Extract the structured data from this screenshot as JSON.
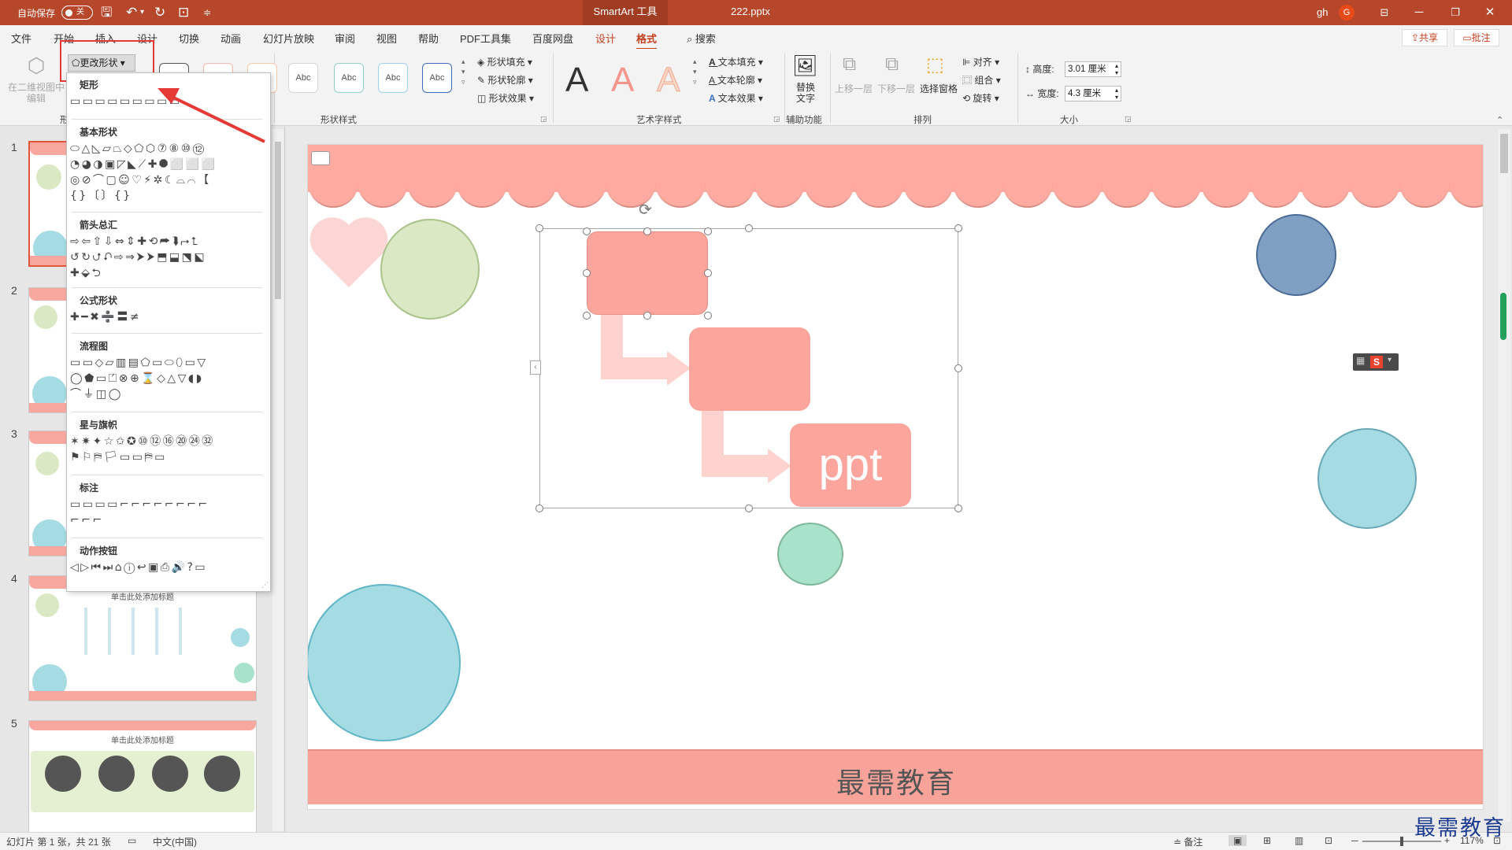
{
  "titlebar": {
    "autosave_label": "自动保存",
    "autosave_state": "关",
    "context_tab": "SmartArt 工具",
    "filename": "222.pptx",
    "user": "gh",
    "avatar_initial": "G"
  },
  "tabs": [
    "文件",
    "开始",
    "插入",
    "设计",
    "切换",
    "动画",
    "幻灯片放映",
    "审阅",
    "视图",
    "帮助",
    "PDF工具集",
    "百度网盘",
    "设计",
    "格式"
  ],
  "search_label": "搜索",
  "share_label": "共享",
  "comment_label": "批注",
  "ribbon": {
    "edit_in_2d": "在二维视图中编辑",
    "change_shape": "更改形状",
    "shape_styles_label": "形状样式",
    "abc_label": "Abc",
    "shape_fill": "形状填充",
    "shape_outline": "形状轮廓",
    "shape_effects": "形状效果",
    "wordart_label": "艺术字样式",
    "text_fill": "文本填充",
    "text_outline": "文本轮廓",
    "text_effects": "文本效果",
    "alt_text": "替换文字",
    "accessibility_label": "辅助功能",
    "bring_forward": "上移一层",
    "send_backward": "下移一层",
    "selection_pane": "选择窗格",
    "align": "对齐",
    "group": "组合",
    "rotate": "旋转",
    "arrange_label": "排列",
    "height_label": "高度:",
    "height_value": "3.01 厘米",
    "width_label": "宽度:",
    "width_value": "4.3 厘米",
    "size_label": "大小",
    "group_tail_label": "形"
  },
  "gallery": {
    "categories": [
      {
        "title": "矩形",
        "rows": [
          "▭▭▭▭▭▭▭▭▭"
        ]
      },
      {
        "title": "基本形状",
        "rows": [
          "⬭△◺▱⏢◇⬠⬡⑦⑧⑩⑫",
          "◔◕◑▣◸◣⟋✚⯃⬜⬜⬜",
          "◎⊘⌒▢☺♡⚡✲☾⌓⌒【",
          "{}〔〕{}"
        ]
      },
      {
        "title": "箭头总汇",
        "rows": [
          "⇨⇦⇧⇩⇔⇕✚⟲⮫⮯⮣⮤",
          "↺↻⮍⮏⇨⇒⮞⮞⬒⬓⬔⬕",
          "✚⬙⮌"
        ]
      },
      {
        "title": "公式形状",
        "rows": [
          "✚━✖➗〓≠"
        ]
      },
      {
        "title": "流程图",
        "rows": [
          "▭▭◇▱▥▤⬠▭⬭⬯▭▽",
          "◯⬟▭⏍⊗⊕⌛◇△▽◖◗",
          "⌒⏚◫◯"
        ]
      },
      {
        "title": "星与旗帜",
        "rows": [
          "✶✷✦☆✩✪⑩⑫⑯⑳㉔㉜",
          "⚑⚐⛿🏳▭▭⛿▭"
        ]
      },
      {
        "title": "标注",
        "rows": [
          "▭▭▭▭⌐⌐⌐⌐⌐⌐⌐⌐",
          "⌐⌐⌐"
        ]
      },
      {
        "title": "动作按钮",
        "rows": [
          "◁▷⏮⏭⌂ⓘ↩▣⎙🔊?▭"
        ]
      }
    ]
  },
  "slides": {
    "numbers": [
      "1",
      "2",
      "3",
      "4",
      "5"
    ],
    "thumb4_title": "单击此处添加标题",
    "thumb5_title": "单击此处添加标题"
  },
  "slide": {
    "box3_text": "ppt",
    "footer_text": "最需教育"
  },
  "statusbar": {
    "slide_info": "幻灯片 第 1 张，共 21 张",
    "language": "中文(中国)",
    "notes": "备注",
    "zoom": "117%"
  },
  "watermark": "最需教育",
  "colors": {
    "titlebar": "#b7472a",
    "accent": "#c43e1c",
    "salmon": "#ffaba2",
    "blue_circle": "#7f9fc3",
    "teal_circle": "#a5dbe3",
    "green_circle": "#dbe8c4",
    "mint_circle": "#a9e2cb"
  }
}
